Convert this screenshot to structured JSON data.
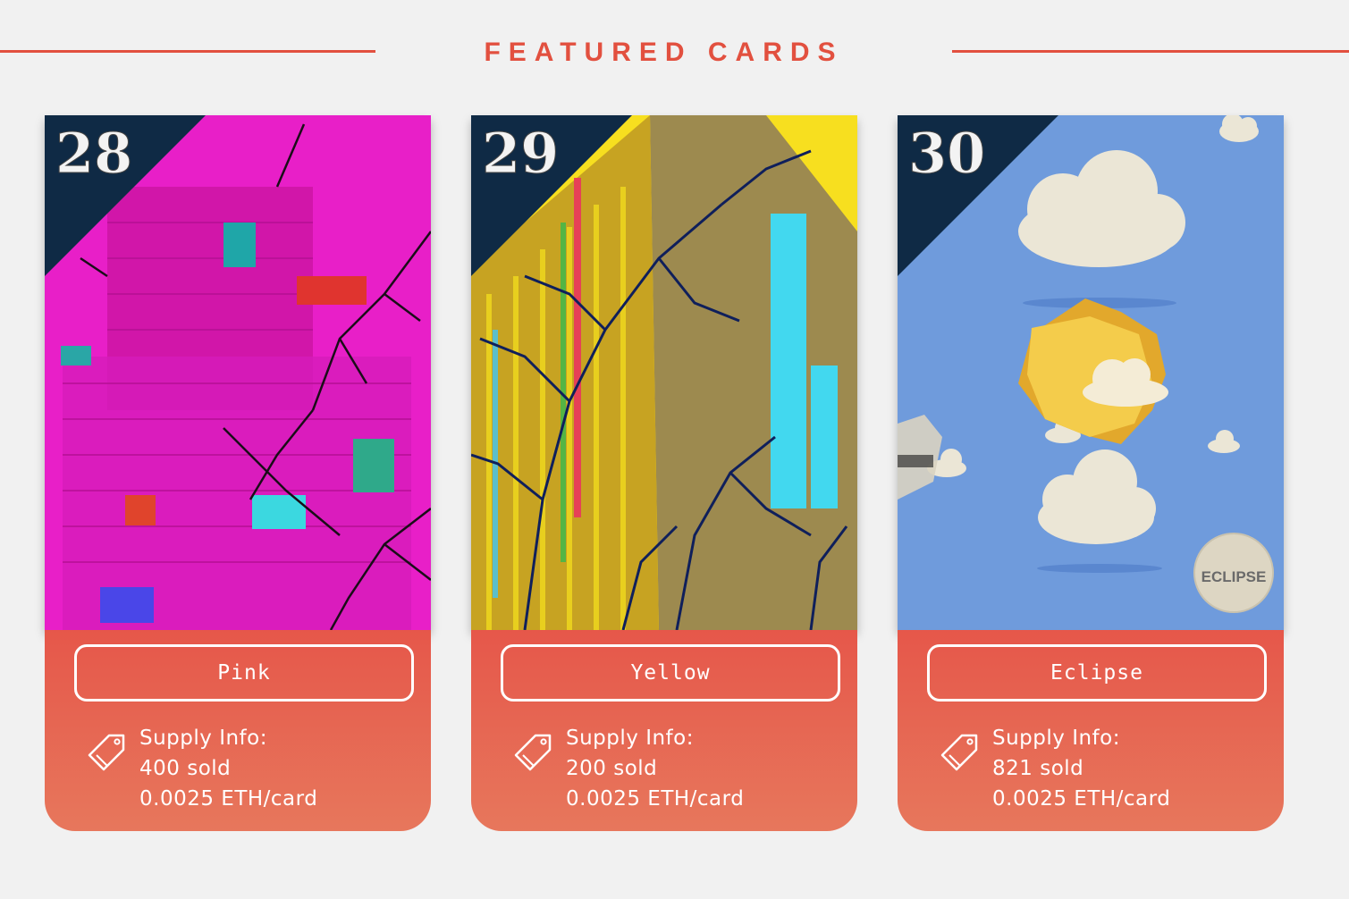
{
  "header": {
    "title": "FEATURED CARDS"
  },
  "cards": [
    {
      "number": "28",
      "name": "Pink",
      "supply_label": "Supply Info:",
      "sold": "400 sold",
      "price": "0.0025 ETH/card",
      "art": "pink-building-art"
    },
    {
      "number": "29",
      "name": "Yellow",
      "supply_label": "Supply Info:",
      "sold": "200 sold",
      "price": "0.0025 ETH/card",
      "art": "yellow-building-art"
    },
    {
      "number": "30",
      "name": "Eclipse",
      "supply_label": "Supply Info:",
      "sold": "821 sold",
      "price": "0.0025 ETH/card",
      "art": "eclipse-sky-art",
      "coin_text": "ECLIPSE"
    }
  ],
  "colors": {
    "accent": "#e2503f",
    "background": "#f1f1f1",
    "pink": "#e81fc8",
    "yellow": "#f7df1f",
    "sky": "#6f9bdc"
  },
  "icons": {
    "price": "price-tag-icon"
  }
}
